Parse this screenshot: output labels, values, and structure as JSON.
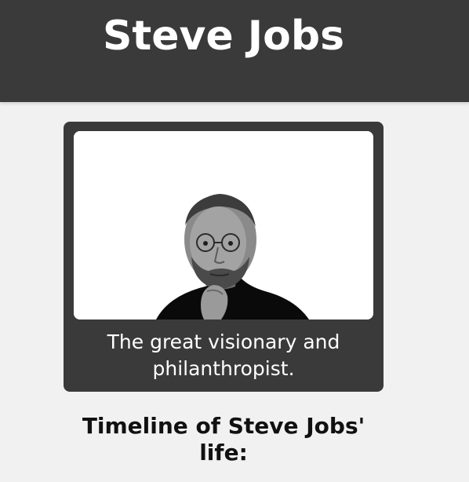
{
  "header": {
    "title": "Steve Jobs"
  },
  "tribute": {
    "image_alt": "Portrait of Steve Jobs",
    "caption": "The great visionary and philanthropist."
  },
  "timeline": {
    "heading": "Timeline of Steve Jobs' life:"
  },
  "colors": {
    "header_bg": "#3a3a3a",
    "page_bg": "#f1f1f1",
    "card_bg": "#3a3a3a",
    "text_light": "#ffffff",
    "text_dark": "#111111"
  }
}
